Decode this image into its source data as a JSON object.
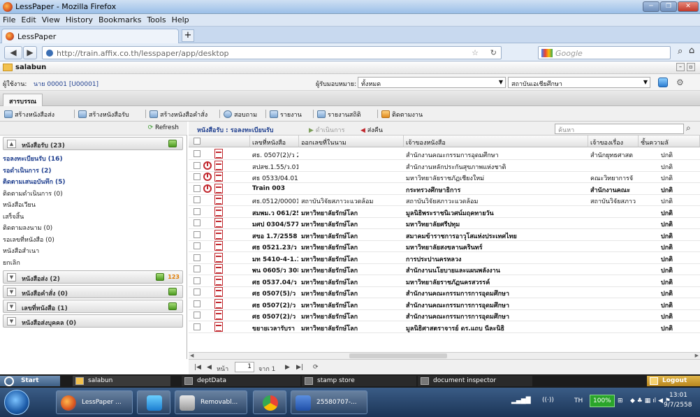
{
  "browser": {
    "window_title": "LessPaper - Mozilla Firefox",
    "menu": [
      "File",
      "Edit",
      "View",
      "History",
      "Bookmarks",
      "Tools",
      "Help"
    ],
    "tab_title": "LessPaper",
    "url": "http://train.affix.co.th/lesspaper/app/desktop",
    "search_placeholder": "Google"
  },
  "app": {
    "window_name": "salabun",
    "user_label": "ผู้ใช้งาน:",
    "user_value": "นาย 00001 [U00001]",
    "assignee_label": "ผู้รับมอบหมาย:",
    "assignee_value": "ทั้งหมด",
    "org_value": "สถาบันเอเชียศึกษา",
    "section_tab": "สารบรรณ",
    "toolbar": [
      "สร้างหนังสือส่ง",
      "สร้างหนังสือรับ",
      "สร้างหนังสือคำสั่ง",
      "สอบถาม",
      "รายงาน",
      "รายงานสถิติ",
      "ติดตามงาน"
    ]
  },
  "sidebar": {
    "refresh_label": "Refresh",
    "groups": [
      {
        "label": "หนังสือรับ (23)"
      },
      {
        "label": "หนังสือส่ง (2)",
        "badge": "123"
      },
      {
        "label": "หนังสือคำสั่ง (0)"
      },
      {
        "label": "เลขที่หนังสือ (1)"
      },
      {
        "label": "หนังสือส่งบุคคล (0)"
      }
    ],
    "items": [
      {
        "label": "รอลงทะเบียนรับ (16)",
        "bold": true
      },
      {
        "label": "รอดำเนินการ (2)",
        "bold": true
      },
      {
        "label": "ติดตามเสนอบันทึก (5)",
        "bold": true
      },
      {
        "label": "ติดตามดำเนินการ (0)",
        "bold": false
      },
      {
        "label": "หนังสือเวียน",
        "bold": false
      },
      {
        "label": "เสร็จสิ้น",
        "bold": false
      },
      {
        "label": "ติดตามลงนาม (0)",
        "bold": false
      },
      {
        "label": "รอเลขที่หนังสือ (0)",
        "bold": false
      },
      {
        "label": "หนังสือสำเนา",
        "bold": false
      },
      {
        "label": "ยกเลิก",
        "bold": false
      }
    ]
  },
  "main": {
    "title": "หนังสือรับ : รอลงทะเบียนรับ",
    "action_process": "ดำเนินการ",
    "action_return": "ส่งคืน",
    "search_placeholder": "ค้นหา",
    "columns": [
      "เลขที่หนังสือ",
      "ออกเลขที่ในนาม",
      "เจ้าของหนังสือ",
      "เจ้าของเรื่อง",
      "ชั้นความลั"
    ],
    "rows": [
      {
        "no": "ศธ. 0507(2)/ว 2",
        "issuer": "",
        "owner": "สำนักงานคณะกรรมการอุดมศึกษา",
        "subject_owner": "สำนักยุทธศาสต",
        "secret": "ปกติ",
        "clock": false,
        "bold": false
      },
      {
        "no": "สปสช.1.55/ว.01",
        "issuer": "",
        "owner": "สำนักงานหลักประกันสุขภาพแห่งชาติ",
        "subject_owner": "",
        "secret": "ปกติ",
        "clock": true,
        "bold": false
      },
      {
        "no": "ศธ 0533/04.01/",
        "issuer": "",
        "owner": "มหาวิทยาลัยราชภัฏเชียงใหม่",
        "subject_owner": "คณะวิทยาการจั",
        "secret": "ปกติ",
        "clock": true,
        "bold": false
      },
      {
        "no": "Train 003",
        "issuer": "",
        "owner": "กระทรวงศึกษาธิการ",
        "subject_owner": "สำนักงานคณะ",
        "secret": "ปกติ",
        "clock": true,
        "bold": true
      },
      {
        "no": "ศธ.0512/00001",
        "issuer": "สถาบันวิจัยสภาวะแวดล้อม",
        "owner": "สถาบันวิจัยสภาวะแวดล้อม",
        "subject_owner": "สถาบันวิจัยสภาว",
        "secret": "ปกติ",
        "clock": false,
        "bold": false
      },
      {
        "no": "สมพม.ว 061/25",
        "issuer": "มหาวิทยาลัยรักษ์โลก",
        "owner": "มูลนิธิพระราชนิเวศน์มฤคทายวัน",
        "subject_owner": "",
        "secret": "ปกติ",
        "clock": false,
        "bold": true
      },
      {
        "no": "มศป 0304/577",
        "issuer": "มหาวิทยาลัยรักษ์โลก",
        "owner": "มหาวิทยาลัยศรีปทุม",
        "subject_owner": "",
        "secret": "ปกติ",
        "clock": false,
        "bold": true
      },
      {
        "no": "สขอ 1.7/2558",
        "issuer": "มหาวิทยาลัยรักษ์โลก",
        "owner": "สมาคมข้าราชการอาวุโสแห่งประเทศไทย",
        "subject_owner": "",
        "secret": "ปกติ",
        "clock": false,
        "bold": true
      },
      {
        "no": "ศธ 0521.23/ว 1",
        "issuer": "มหาวิทยาลัยรักษ์โลก",
        "owner": "มหาวิทยาลัยสงขลานครินทร์",
        "subject_owner": "",
        "secret": "ปกติ",
        "clock": false,
        "bold": true
      },
      {
        "no": "มท 5410-4-1.1.",
        "issuer": "มหาวิทยาลัยรักษ์โลก",
        "owner": "การประปานครหลวง",
        "subject_owner": "",
        "secret": "ปกติ",
        "clock": false,
        "bold": true
      },
      {
        "no": "พน 0605/ว 308",
        "issuer": "มหาวิทยาลัยรักษ์โลก",
        "owner": "สำนักงานนโยบายและแผนพลังงาน",
        "subject_owner": "",
        "secret": "ปกติ",
        "clock": false,
        "bold": true
      },
      {
        "no": "ศธ 0537.04/ว 7",
        "issuer": "มหาวิทยาลัยรักษ์โลก",
        "owner": "มหาวิทยาลัยราชภัฏนครสวรรค์",
        "subject_owner": "",
        "secret": "ปกติ",
        "clock": false,
        "bold": true
      },
      {
        "no": "ศธ 0507(5)/ว 8",
        "issuer": "มหาวิทยาลัยรักษ์โลก",
        "owner": "สำนักงานคณะกรรมการการอุดมศึกษา",
        "subject_owner": "",
        "secret": "ปกติ",
        "clock": false,
        "bold": true
      },
      {
        "no": "ศธ 0507(2)/ว 8",
        "issuer": "มหาวิทยาลัยรักษ์โลก",
        "owner": "สำนักงานคณะกรรมการการอุดมศึกษา",
        "subject_owner": "",
        "secret": "ปกติ",
        "clock": false,
        "bold": true
      },
      {
        "no": "ศธ 0507(2)/ว 8",
        "issuer": "มหาวิทยาลัยรักษ์โลก",
        "owner": "สำนักงานคณะกรรมการการอุดมศึกษา",
        "subject_owner": "",
        "secret": "ปกติ",
        "clock": false,
        "bold": true
      },
      {
        "no": "ขยายเวลารับรา",
        "issuer": "มหาวิทยาลัยรักษ์โลก",
        "owner": "มูลนิธิศาสตราจารย์ ดร.แถบ นีละนิธิ",
        "subject_owner": "",
        "secret": "ปกติ",
        "clock": false,
        "bold": true
      }
    ],
    "pager_page_label": "หน้า",
    "pager_page": "1",
    "pager_of": "จาก 1"
  },
  "app_taskbar": {
    "start": "Start",
    "items": [
      "salabun",
      "deptData",
      "stamp store",
      "document inspector"
    ],
    "logout": "Logout"
  },
  "windows_taskbar": {
    "tasks": [
      "LessPaper ...",
      "",
      "Removabl...",
      "",
      "25580707-..."
    ],
    "lang": "TH",
    "battery": "100%",
    "time": "13:01",
    "date": "9/7/2558"
  }
}
